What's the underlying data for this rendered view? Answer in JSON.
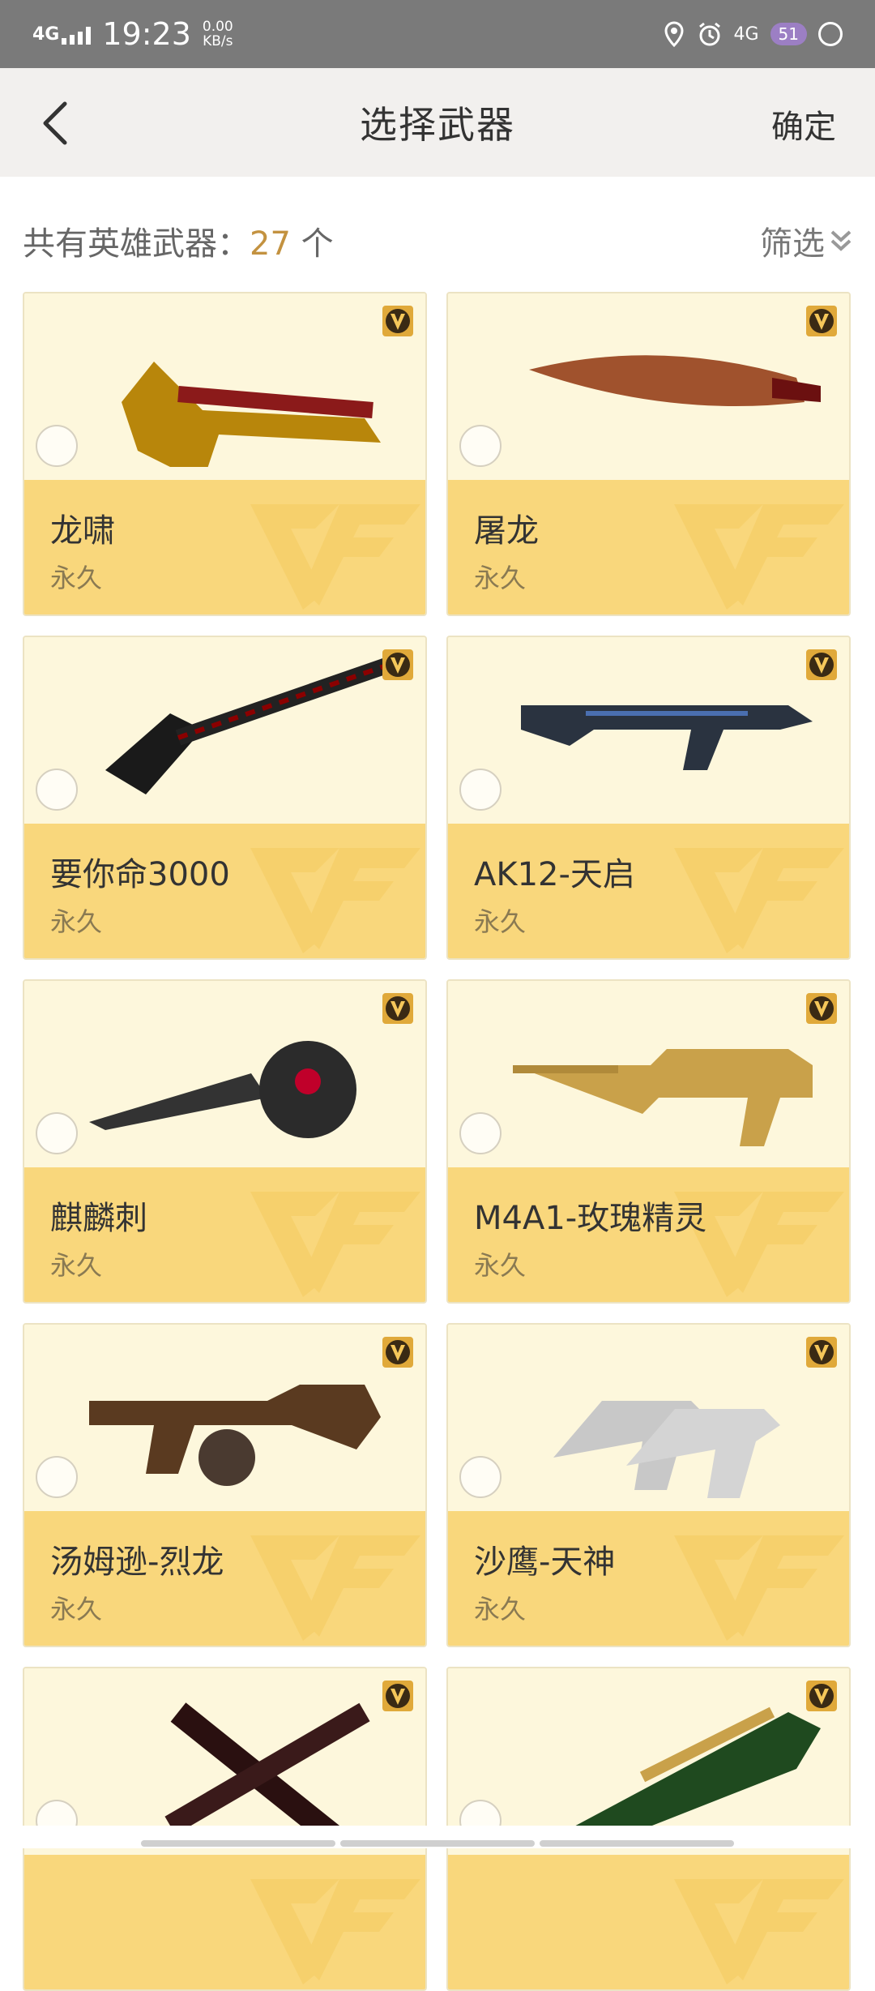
{
  "status_bar": {
    "network": "4G",
    "time": "19:23",
    "speed_value": "0.00",
    "speed_unit": "KB/s",
    "network_right": "4G",
    "badge": "51"
  },
  "header": {
    "title": "选择武器",
    "confirm_label": "确定",
    "back_icon": "chevron-left-icon"
  },
  "summary": {
    "prefix": "共有英雄武器：",
    "count": "27",
    "unit": " 个",
    "filter_label": "筛选"
  },
  "weapons": [
    {
      "name": "龙啸",
      "duration": "永久"
    },
    {
      "name": "屠龙",
      "duration": "永久"
    },
    {
      "name": "要你命3000",
      "duration": "永久"
    },
    {
      "name": "AK12-天启",
      "duration": "永久"
    },
    {
      "name": "麒麟刺",
      "duration": "永久"
    },
    {
      "name": "M4A1-玫瑰精灵",
      "duration": "永久"
    },
    {
      "name": "汤姆逊-烈龙",
      "duration": "永久"
    },
    {
      "name": "沙鹰-天神",
      "duration": "永久"
    },
    {
      "name": "",
      "duration": ""
    },
    {
      "name": "",
      "duration": ""
    }
  ],
  "colors": {
    "card_top": "#fdf7dc",
    "card_bottom": "#f9d77c",
    "count_accent": "#c39240",
    "status_bar": "#7a7a7a"
  }
}
